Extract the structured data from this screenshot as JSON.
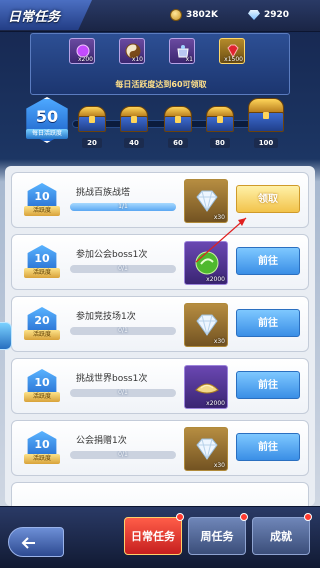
{
  "header": {
    "title": "日常任务",
    "coins": "3802K",
    "gems": "2920"
  },
  "banner": {
    "rewards": [
      {
        "name": "purple-orb",
        "qty": "x200",
        "style": "purple"
      },
      {
        "name": "yin-yang",
        "qty": "x10",
        "style": "purple"
      },
      {
        "name": "crystal-bag",
        "qty": "x1",
        "style": "purple"
      },
      {
        "name": "red-gem",
        "qty": "x1500",
        "style": "gold"
      }
    ],
    "text": "每日活跃度达到60可领取"
  },
  "progress": {
    "current": "50",
    "label": "每日活跃度",
    "milestones": [
      "20",
      "40",
      "60",
      "80",
      "100"
    ]
  },
  "tasks": [
    {
      "badge": "10",
      "badge_label": "活跃度",
      "name": "挑战百族战塔",
      "progress": "1/1",
      "ratio": 1.0,
      "reward_qty": "x30",
      "reward_icon": "diamond-icon",
      "button": "领取",
      "button_type": "claim"
    },
    {
      "badge": "10",
      "badge_label": "活跃度",
      "name": "参加公会boss1次",
      "progress": "0/1",
      "ratio": 0.0,
      "reward_qty": "x2000",
      "reward_icon": "green-orb-icon",
      "button": "前往",
      "button_type": "goto"
    },
    {
      "badge": "20",
      "badge_label": "活跃度",
      "name": "参加竞技场1次",
      "progress": "0/1",
      "ratio": 0.0,
      "reward_qty": "x30",
      "reward_icon": "diamond-icon",
      "button": "前往",
      "button_type": "goto"
    },
    {
      "badge": "10",
      "badge_label": "活跃度",
      "name": "挑战世界boss1次",
      "progress": "0/1",
      "ratio": 0.0,
      "reward_qty": "x2000",
      "reward_icon": "gold-ingot-icon",
      "button": "前往",
      "button_type": "goto"
    },
    {
      "badge": "10",
      "badge_label": "活跃度",
      "name": "公会捐赠1次",
      "progress": "0/1",
      "ratio": 0.0,
      "reward_qty": "x30",
      "reward_icon": "diamond-icon",
      "button": "前往",
      "button_type": "goto"
    }
  ],
  "footer": {
    "tabs": [
      "日常任务",
      "周任务",
      "成就"
    ]
  }
}
